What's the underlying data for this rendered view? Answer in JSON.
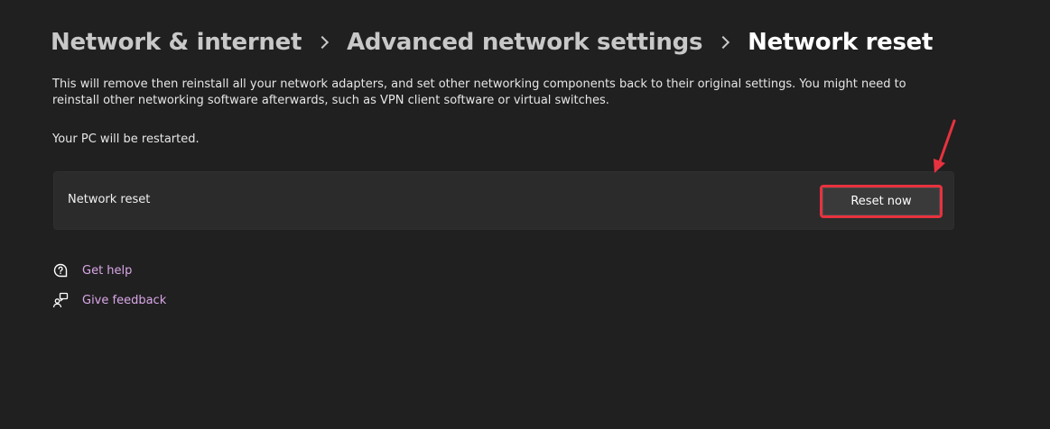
{
  "breadcrumb": {
    "items": [
      "Network & internet",
      "Advanced network settings",
      "Network reset"
    ]
  },
  "description": "This will remove then reinstall all your network adapters, and set other networking components back to their original settings. You might need to reinstall other networking software afterwards, such as VPN client software or virtual switches.",
  "restart_note": "Your PC will be restarted.",
  "card": {
    "label": "Network reset",
    "button_label": "Reset now"
  },
  "links": {
    "get_help": "Get help",
    "give_feedback": "Give feedback"
  },
  "icons": {
    "chevron": "chevron-right-icon",
    "help": "help-icon",
    "feedback": "feedback-icon",
    "annotation": "red-arrow-icon"
  },
  "colors": {
    "background": "#202020",
    "card": "#2b2b2b",
    "accent_link": "#d9a7e8",
    "highlight": "#e8323f"
  }
}
